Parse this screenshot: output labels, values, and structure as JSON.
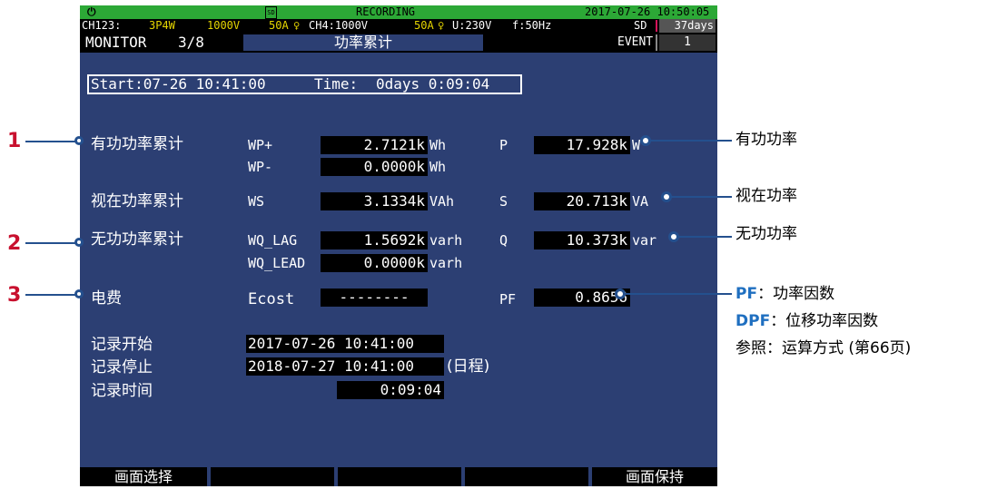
{
  "status_bar": {
    "recording": "RECORDING",
    "datetime": "2017-07-26 10:50:05"
  },
  "config_bar": {
    "ch123": "CH123:",
    "wiring": "3P4W",
    "ch123_range": "1000V",
    "ch123_clamp": "50A",
    "ch4": "CH4:1000V",
    "ch4_clamp": "50A",
    "voltage": "U:230V",
    "freq": "f:50Hz",
    "sd": "SD",
    "sd_days": "37days"
  },
  "header": {
    "monitor": "MONITOR",
    "page": "3/8",
    "title": "功率累计",
    "event_label": "EVENT",
    "event_count": "1"
  },
  "time_box": {
    "start": "Start:07-26 10:41:00",
    "time_label": "Time:",
    "elapsed": "0days  0:09:04"
  },
  "rows": {
    "active": {
      "label": "有功功率累计",
      "wp_plus_sym": "WP+",
      "wp_plus_val": "2.7121k",
      "wp_plus_unit": "Wh",
      "wp_minus_sym": "WP-",
      "wp_minus_val": "0.0000k",
      "wp_minus_unit": "Wh",
      "p_sym": "P",
      "p_val": "17.928k",
      "p_unit": "W"
    },
    "apparent": {
      "label": "视在功率累计",
      "ws_sym": "WS",
      "ws_val": "3.1334k",
      "ws_unit": "VAh",
      "s_sym": "S",
      "s_val": "20.713k",
      "s_unit": "VA"
    },
    "reactive": {
      "label": "无功功率累计",
      "lag_sym": "WQ_LAG",
      "lag_val": "1.5692k",
      "lag_unit": "varh",
      "lead_sym": "WQ_LEAD",
      "lead_val": "0.0000k",
      "lead_unit": "varh",
      "q_sym": "Q",
      "q_val": "10.373k",
      "q_unit": "var"
    },
    "cost": {
      "label": "电费",
      "ecost_sym": "Ecost",
      "ecost_val": "--------",
      "pf_sym": "PF",
      "pf_val": "0.8656"
    }
  },
  "record": {
    "start_label": "记录开始",
    "start_val": "2017-07-26 10:41:00",
    "stop_label": "记录停止",
    "stop_val": "2018-07-27 10:41:00",
    "stop_note": "(日程)",
    "time_label": "记录时间",
    "time_val": "0:09:04"
  },
  "function_keys": {
    "f1": "画面选择",
    "f5": "画面保持"
  },
  "annotations": {
    "n1": "1",
    "n2": "2",
    "n3": "3",
    "active_power": "有功功率",
    "apparent_power": "视在功率",
    "reactive_power": "无功功率",
    "pf_abbr": "PF",
    "pf_desc": "：功率因数",
    "dpf_abbr": "DPF",
    "dpf_desc": "：位移功率因数",
    "ref": "参照：运算方式 (第66页)"
  },
  "colors": {
    "screen_bg": "#2c3f73",
    "status_green": "#2ca836",
    "accent_yellow": "#e6d600",
    "callout_red": "#c8102e",
    "callout_blue": "#1f6fc0"
  }
}
